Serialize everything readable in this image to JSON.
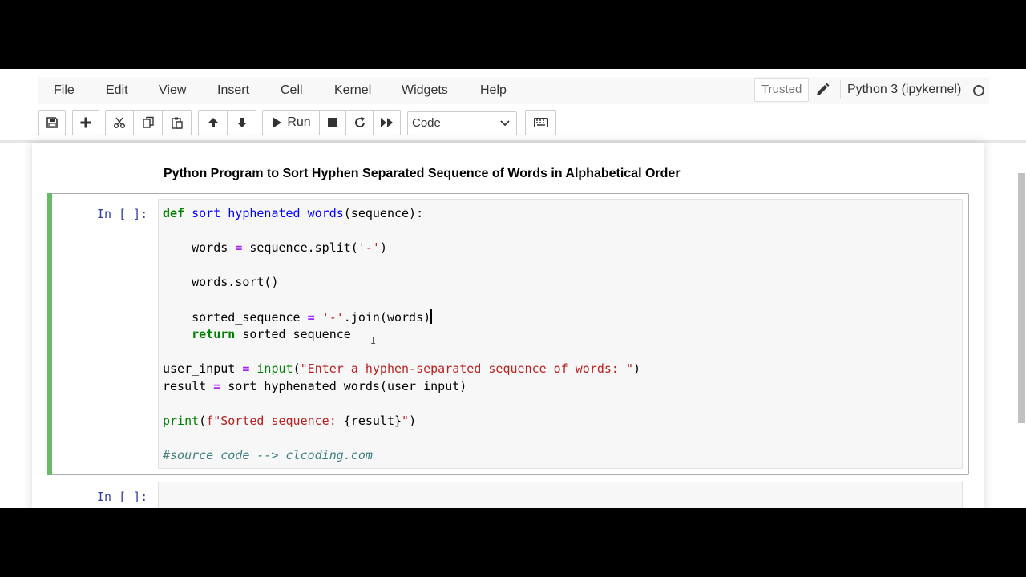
{
  "menubar": {
    "items": [
      "File",
      "Edit",
      "View",
      "Insert",
      "Cell",
      "Kernel",
      "Widgets",
      "Help"
    ],
    "trusted": "Trusted",
    "kernel_name": "Python 3 (ipykernel)"
  },
  "toolbar": {
    "run_label": "Run",
    "cell_type": "Code"
  },
  "notebook": {
    "markdown_title": "Python Program to Sort Hyphen Separated Sequence of Words in Alphabetical Order",
    "cell1_prompt": "In [ ]:",
    "cell2_prompt": "In [ ]:"
  },
  "code": {
    "l1_kw": "def",
    "l1_fn": "sort_hyphenated_words",
    "l1_rest": "(sequence):",
    "l3_a": "    words ",
    "l3_op": "=",
    "l3_b": " sequence.split(",
    "l3_str": "'-'",
    "l3_c": ")",
    "l5": "    words.sort()",
    "l7_a": "    sorted_sequence ",
    "l7_op": "=",
    "l7_sp": " ",
    "l7_str": "'-'",
    "l7_b": ".join(words)",
    "l8_kw": "    return",
    "l8_b": " sorted_sequence",
    "l10_a": "user_input ",
    "l10_op": "=",
    "l10_sp": " ",
    "l10_bi": "input",
    "l10_b": "(",
    "l10_str": "\"Enter a hyphen-separated sequence of words: \"",
    "l10_c": ")",
    "l11_a": "result ",
    "l11_op": "=",
    "l11_b": " sort_hyphenated_words(user_input)",
    "l13_bi": "print",
    "l13_b": "(",
    "l13_str1": "f\"Sorted sequence: ",
    "l13_int": "{result}",
    "l13_str2": "\"",
    "l13_c": ")",
    "l15_cm": "#source code --> clcoding.com"
  },
  "icons": [
    "save-icon",
    "plus-icon",
    "cut-icon",
    "copy-icon",
    "paste-icon",
    "arrow-up-icon",
    "arrow-down-icon",
    "play-icon",
    "stop-icon",
    "restart-icon",
    "fast-forward-icon",
    "keyboard-icon",
    "pencil-icon",
    "kernel-idle-icon"
  ],
  "colors": {
    "cell_accent": "#66bb6a",
    "prompt": "#303f9f"
  }
}
